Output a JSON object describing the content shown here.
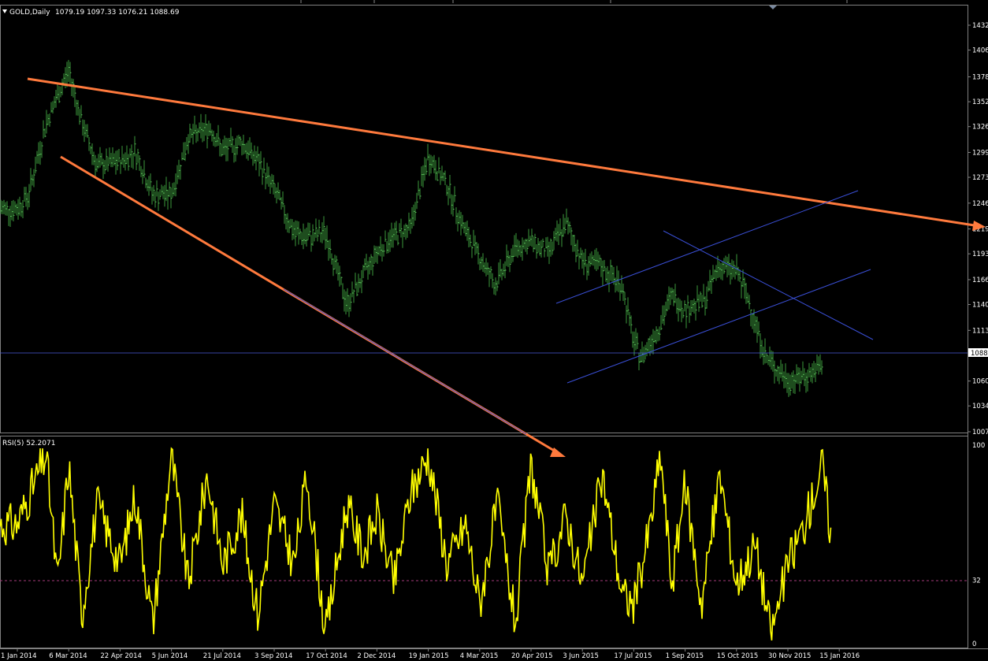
{
  "chart_data": [
    {
      "type": "line",
      "title": "GOLD,Daily",
      "ohlc_label": "1079.19 1097.33 1076.21 1088.69",
      "ylim": [
        1007,
        1432
      ],
      "y_ticks": [
        "1432",
        "1406",
        "1378",
        "1352",
        "1326",
        "1299",
        "1273",
        "1246",
        "1219",
        "1193",
        "1166",
        "1140",
        "1113",
        "1088",
        "1060",
        "1034",
        "1007"
      ],
      "current_price": "1088",
      "x_ticks": [
        "1 Jan 2014",
        "6 Mar 2014",
        "22 Apr 2014",
        "5 Jun 2014",
        "21 Jul 2014",
        "3 Sep 2014",
        "17 Oct 2014",
        "2 Dec 2014",
        "19 Jan 2015",
        "4 Mar 2015",
        "20 Apr 2015",
        "3 Jun 2015",
        "17 Jul 2015",
        "1 Sep 2015",
        "15 Oct 2015",
        "30 Nov 2015",
        "15 Jan 2016"
      ],
      "series": [
        {
          "x": [
            "1 Jan 2014",
            "15 Jan 2014",
            "6 Feb 2014",
            "6 Mar 2014",
            "18 Mar 2014",
            "1 Apr 2014",
            "22 Apr 2014",
            "5 May 2014",
            "20 May 2014",
            "5 Jun 2014",
            "20 Jun 2014",
            "10 Jul 2014",
            "21 Jul 2014",
            "6 Aug 2014",
            "20 Aug 2014",
            "3 Sep 2014",
            "20 Sep 2014",
            "1 Oct 2014",
            "17 Oct 2014",
            "5 Nov 2014",
            "2 Dec 2014",
            "15 Dec 2014",
            "2 Jan 2015",
            "19 Jan 2015",
            "4 Feb 2015",
            "20 Feb 2015",
            "4 Mar 2015",
            "18 Mar 2015",
            "6 Apr 2015",
            "20 Apr 2015",
            "5 May 2015",
            "20 May 2015",
            "3 Jun 2015",
            "18 Jun 2015",
            "7 Jul 2015",
            "17 Jul 2015",
            "24 Jul 2015",
            "10 Aug 2015",
            "20 Aug 2015",
            "1 Sep 2015",
            "18 Sep 2015",
            "29 Sep 2015",
            "15 Oct 2015",
            "27 Oct 2015",
            "10 Nov 2015",
            "30 Nov 2015",
            "15 Dec 2015",
            "31 Dec 2015"
          ],
          "values": [
            1240,
            1255,
            1330,
            1385,
            1330,
            1285,
            1290,
            1300,
            1255,
            1255,
            1315,
            1325,
            1300,
            1310,
            1290,
            1260,
            1215,
            1210,
            1215,
            1140,
            1195,
            1210,
            1220,
            1295,
            1265,
            1215,
            1190,
            1160,
            1200,
            1205,
            1195,
            1225,
            1185,
            1180,
            1160,
            1100,
            1085,
            1120,
            1150,
            1135,
            1145,
            1180,
            1175,
            1140,
            1085,
            1060,
            1065,
            1075
          ]
        }
      ]
    },
    {
      "type": "line",
      "title": "RSI(5) 52.2071",
      "ylim": [
        0,
        100
      ],
      "y_ticks": [
        "100",
        "32",
        "0"
      ],
      "reference_line": 32,
      "series": [
        {
          "name": "RSI(5)",
          "x": [
            "1 Jan 2014",
            "6 Feb 2014",
            "20 Feb 2014",
            "6 Mar 2014",
            "18 Mar 2014",
            "1 Apr 2014",
            "22 Apr 2014",
            "5 May 2014",
            "20 May 2014",
            "5 Jun 2014",
            "20 Jun 2014",
            "7 Jul 2014",
            "21 Jul 2014",
            "6 Aug 2014",
            "20 Aug 2014",
            "3 Sep 2014",
            "20 Sep 2014",
            "1 Oct 2014",
            "17 Oct 2014",
            "5 Nov 2014",
            "20 Nov 2014",
            "2 Dec 2014",
            "18 Dec 2014",
            "2 Jan 2015",
            "19 Jan 2015",
            "4 Feb 2015",
            "20 Feb 2015",
            "4 Mar 2015",
            "20 Mar 2015",
            "6 Apr 2015",
            "20 Apr 2015",
            "5 May 2015",
            "20 May 2015",
            "3 Jun 2015",
            "20 Jun 2015",
            "7 Jul 2015",
            "17 Jul 2015",
            "1 Aug 2015",
            "10 Aug 2015",
            "20 Aug 2015",
            "1 Sep 2015",
            "15 Sep 2015",
            "1 Oct 2015",
            "15 Oct 2015",
            "1 Nov 2015",
            "15 Nov 2015",
            "30 Nov 2015",
            "15 Dec 2015",
            "31 Dec 2015",
            "8 Jan 2016"
          ],
          "values": [
            60,
            95,
            30,
            90,
            15,
            70,
            40,
            75,
            10,
            95,
            30,
            85,
            40,
            65,
            15,
            70,
            40,
            85,
            5,
            70,
            45,
            65,
            30,
            75,
            95,
            40,
            60,
            20,
            70,
            10,
            90,
            35,
            65,
            30,
            85,
            25,
            20,
            60,
            95,
            30,
            80,
            20,
            85,
            30,
            50,
            5,
            40,
            60,
            90,
            52
          ]
        }
      ]
    }
  ],
  "colors": {
    "background": "#000000",
    "candles": "#3c9a3c",
    "orange_trendline": "#ff7a3d",
    "blue_lines": "#3a4fd6",
    "rsi_line": "#ffff00",
    "current_price_line": "#4a5bd8",
    "grid": "#808080",
    "rsi_reference": "#a33a7a"
  }
}
